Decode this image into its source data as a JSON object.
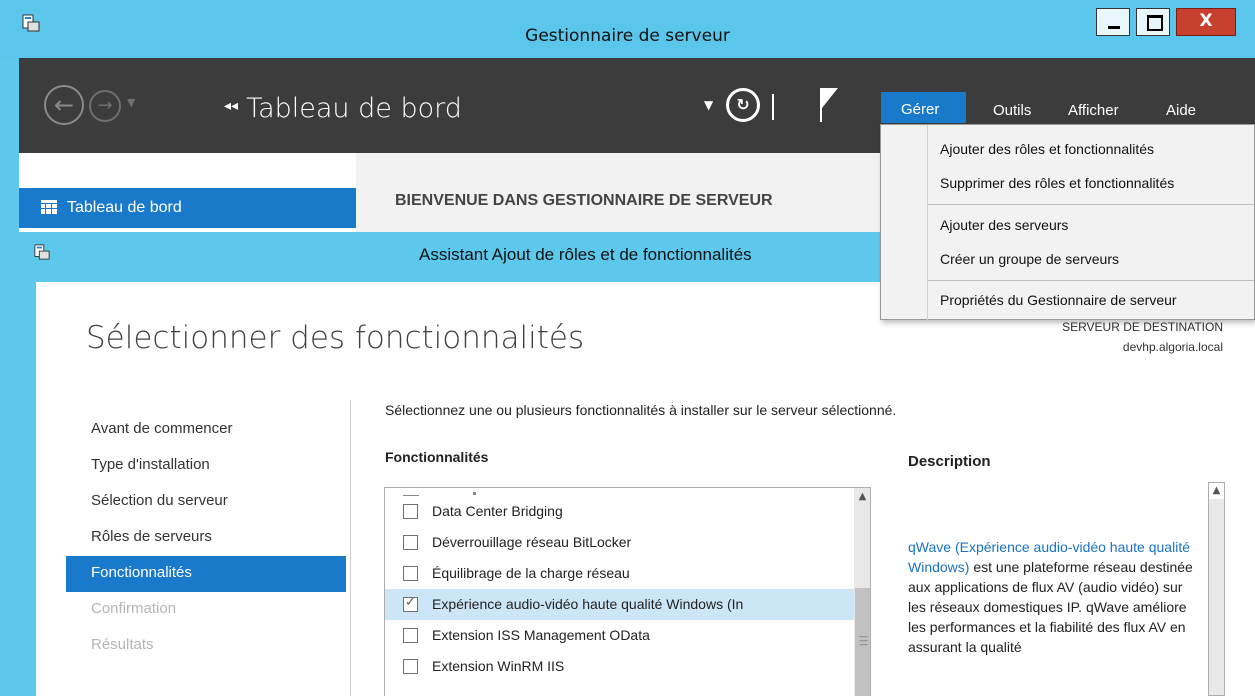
{
  "window": {
    "title": "Gestionnaire de serveur",
    "close_glyph": "X"
  },
  "toolbar": {
    "breadcrumb_arrows": "◂◂",
    "breadcrumb": "Tableau de bord",
    "refresh_icon": "refresh-icon",
    "menus": {
      "manage": "Gérer",
      "tools": "Outils",
      "view": "Afficher",
      "help": "Aide"
    }
  },
  "sidebar": {
    "selected_label": "Tableau de bord"
  },
  "main": {
    "welcome": "BIENVENUE DANS GESTIONNAIRE DE SERVEUR"
  },
  "manage_menu": {
    "items": [
      "Ajouter des rôles et fonctionnalités",
      "Supprimer des rôles et fonctionnalités",
      "Ajouter des serveurs",
      "Créer un groupe de serveurs",
      "Propriétés du Gestionnaire de serveur"
    ]
  },
  "wizard": {
    "title": "Assistant Ajout de rôles et de fonctionnalités",
    "heading": "Sélectionner des fonctionnalités",
    "destination_label": "SERVEUR DE DESTINATION",
    "destination_host": "devhp.algoria.local",
    "steps": [
      "Avant de commencer",
      "Type d'installation",
      "Sélection du serveur",
      "Rôles de serveurs",
      "Fonctionnalités",
      "Confirmation",
      "Résultats"
    ],
    "active_step": 4,
    "intro": "Sélectionnez une ou plusieurs fonctionnalités à installer sur le serveur sélectionné.",
    "features_header": "Fonctionnalités",
    "description_header": "Description",
    "features": [
      {
        "label": "Data Center Bridging",
        "checked": false
      },
      {
        "label": "Déverrouillage réseau BitLocker",
        "checked": false
      },
      {
        "label": "Équilibrage de la charge réseau",
        "checked": false
      },
      {
        "label": "Expérience audio-vidéo haute qualité Windows (In",
        "checked": true,
        "selected": true
      },
      {
        "label": "Extension ISS Management OData",
        "checked": false
      },
      {
        "label": "Extension WinRM IIS",
        "checked": false
      }
    ],
    "description_link": "qWave (Expérience audio-vidéo haute qualité Windows)",
    "description_text": " est une plateforme réseau destinée aux applications de flux AV (audio vidéo) sur les réseaux domestiques IP. qWave améliore les performances et la fiabilité des flux AV en assurant la qualité"
  },
  "colors": {
    "accent": "#1979ca",
    "titlebar": "#5cc8ec",
    "toolbar": "#3c3c3c",
    "link": "#1a73c4"
  }
}
